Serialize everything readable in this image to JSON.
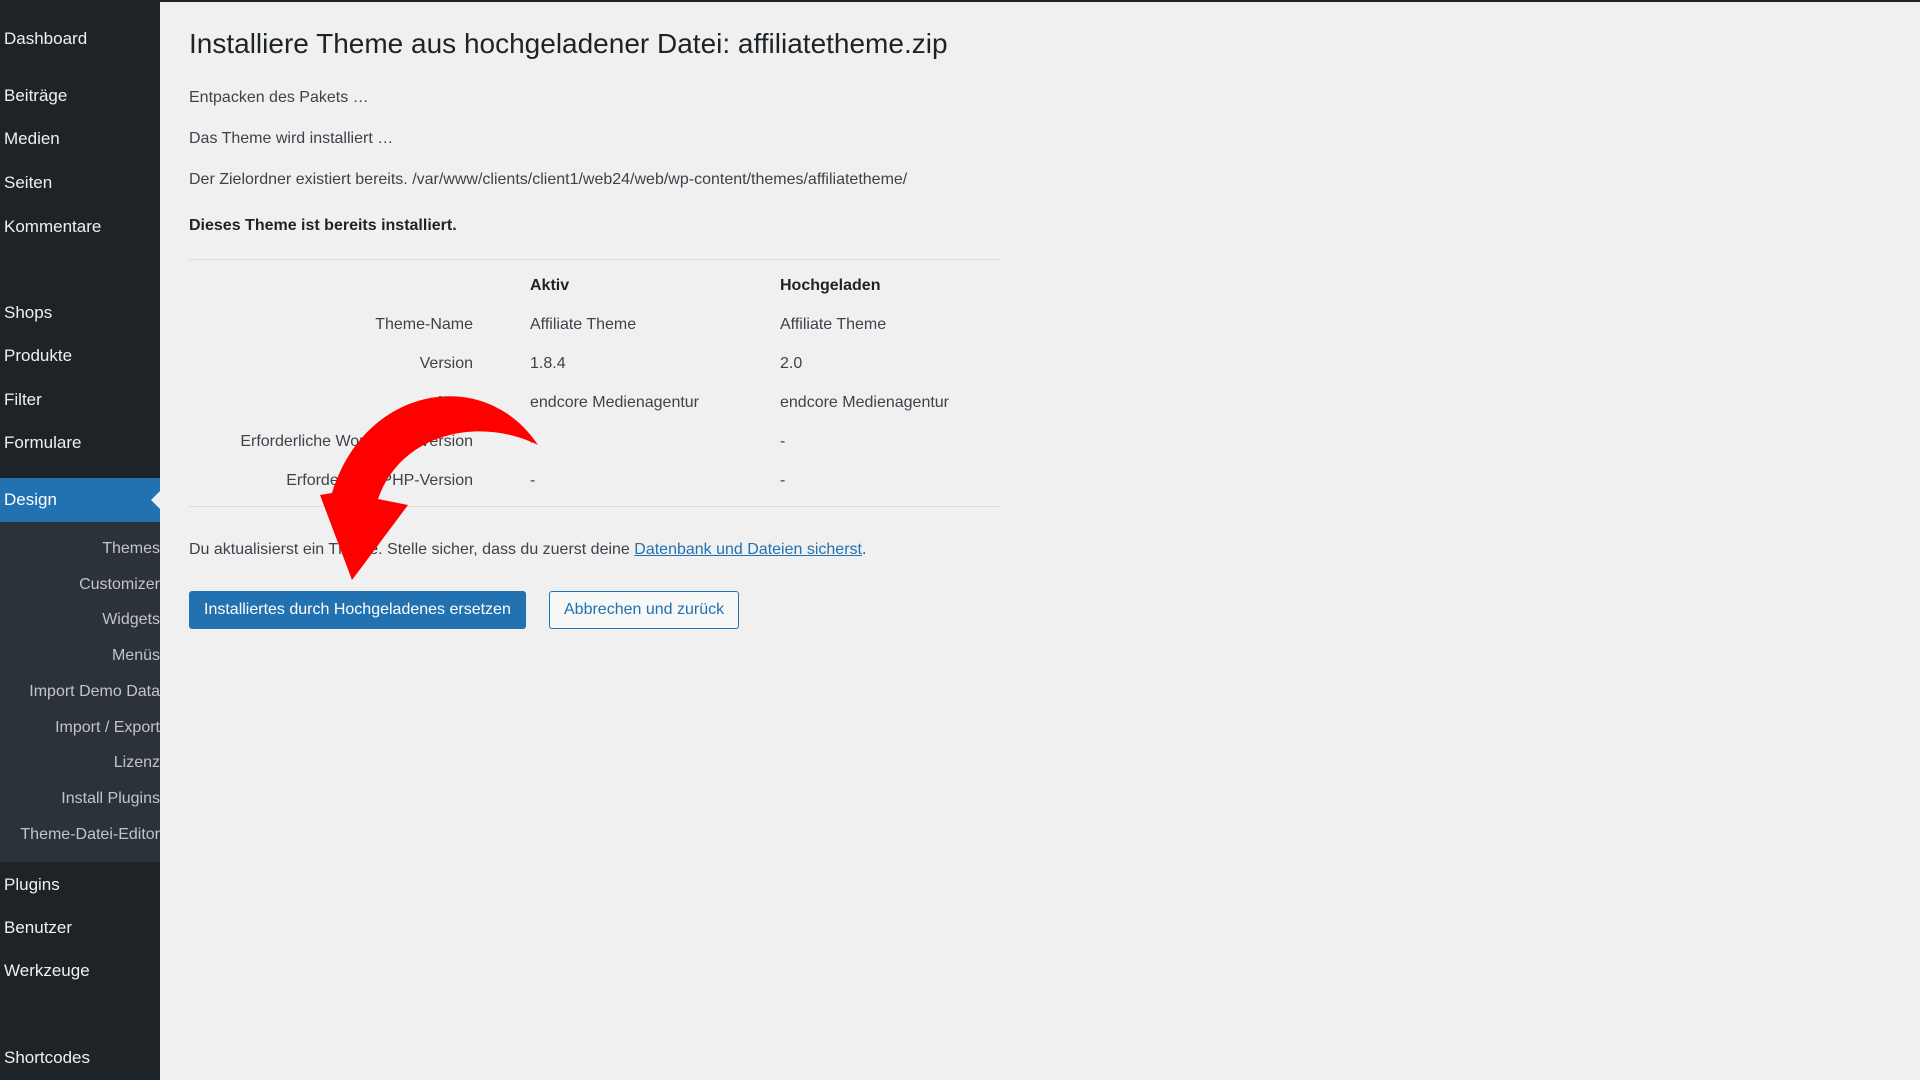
{
  "sidebar": {
    "items": [
      {
        "label": "Dashboard"
      },
      {
        "label": "Beiträge"
      },
      {
        "label": "Medien"
      },
      {
        "label": "Seiten"
      },
      {
        "label": "Kommentare"
      },
      {
        "label": "Shops"
      },
      {
        "label": "Produkte"
      },
      {
        "label": "Filter"
      },
      {
        "label": "Formulare"
      },
      {
        "label": "Design"
      },
      {
        "label": "Plugins"
      },
      {
        "label": "Benutzer"
      },
      {
        "label": "Werkzeuge"
      },
      {
        "label": "Shortcodes"
      }
    ],
    "active_index": 9,
    "submenu": [
      {
        "label": "Themes"
      },
      {
        "label": "Customizer"
      },
      {
        "label": "Widgets"
      },
      {
        "label": "Menüs"
      },
      {
        "label": "Import Demo Data"
      },
      {
        "label": "Import / Export"
      },
      {
        "label": "Lizenz"
      },
      {
        "label": "Install Plugins"
      },
      {
        "label": "Theme-Datei-Editor"
      }
    ]
  },
  "main": {
    "title": "Installiere Theme aus hochgeladener Datei: affiliatetheme.zip",
    "messages": [
      "Entpacken des Pakets …",
      "Das Theme wird installiert …",
      "Der Zielordner existiert bereits. /var/www/clients/client1/web24/web/wp-content/themes/affiliatetheme/"
    ],
    "already_installed": "Dieses Theme ist bereits installiert.",
    "table": {
      "headers": [
        "",
        "Aktiv",
        "Hochgeladen"
      ],
      "rows": [
        {
          "label": "Theme-Name",
          "active": "Affiliate Theme",
          "uploaded": "Affiliate Theme"
        },
        {
          "label": "Version",
          "active": "1.8.4",
          "uploaded": "2.0"
        },
        {
          "label": "Autor",
          "active": "endcore Medienagentur",
          "uploaded": "endcore Medienagentur"
        },
        {
          "label": "Erforderliche WordPress-Version",
          "active": "-",
          "uploaded": "-"
        },
        {
          "label": "Erforderliche PHP-Version",
          "active": "-",
          "uploaded": "-"
        }
      ]
    },
    "notice": {
      "prefix": "Du aktualisierst ein Theme. Stelle sicher, dass du zuerst deine ",
      "link": "Datenbank und Dateien sicherst",
      "suffix": "."
    },
    "buttons": {
      "replace": "Installiertes durch Hochgeladenes ersetzen",
      "cancel": "Abbrechen und zurück"
    }
  },
  "colors": {
    "sidebar_bg": "#1d2327",
    "submenu_bg": "#2c3338",
    "accent": "#2271b1",
    "arrow": "#ff0000",
    "page_bg": "#f0f0f1"
  }
}
